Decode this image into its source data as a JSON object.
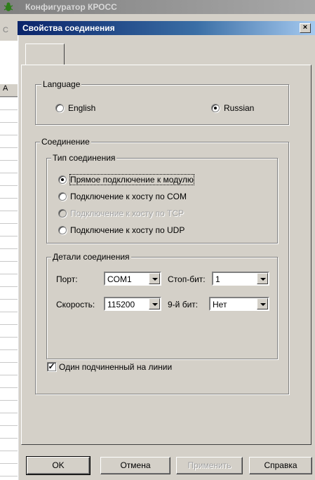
{
  "background_window": {
    "title": "Конфигуратор КРОСС",
    "menu_letter": "С",
    "column_header": "А"
  },
  "dialog": {
    "title": "Свойства соединения",
    "close_label": "×"
  },
  "language": {
    "legend": "Language",
    "options": [
      {
        "label": "English",
        "checked": false
      },
      {
        "label": "Russian",
        "checked": true
      }
    ]
  },
  "connection": {
    "legend": "Соединение",
    "type_group": {
      "legend": "Тип соединения",
      "options": [
        {
          "label": "Прямое подключение к модулю",
          "checked": true,
          "enabled": true
        },
        {
          "label": "Подключение к хосту по COM",
          "checked": false,
          "enabled": true
        },
        {
          "label": "Подключение к хосту по TCP",
          "checked": false,
          "enabled": false
        },
        {
          "label": "Подключение к хосту по UDP",
          "checked": false,
          "enabled": true
        }
      ]
    },
    "details_group": {
      "legend": "Детали соединения",
      "port_label": "Порт:",
      "port_value": "COM1",
      "stopbits_label": "Стоп-бит:",
      "stopbits_value": "1",
      "speed_label": "Скорость:",
      "speed_value": "115200",
      "ninth_bit_label": "9-й бит:",
      "ninth_bit_value": "Нет"
    },
    "single_slave": {
      "label": "Один подчиненный на линии",
      "checked": true,
      "mark": "✓"
    }
  },
  "buttons": {
    "ok": "OK",
    "cancel": "Отмена",
    "apply": "Применить",
    "help": "Справка"
  }
}
